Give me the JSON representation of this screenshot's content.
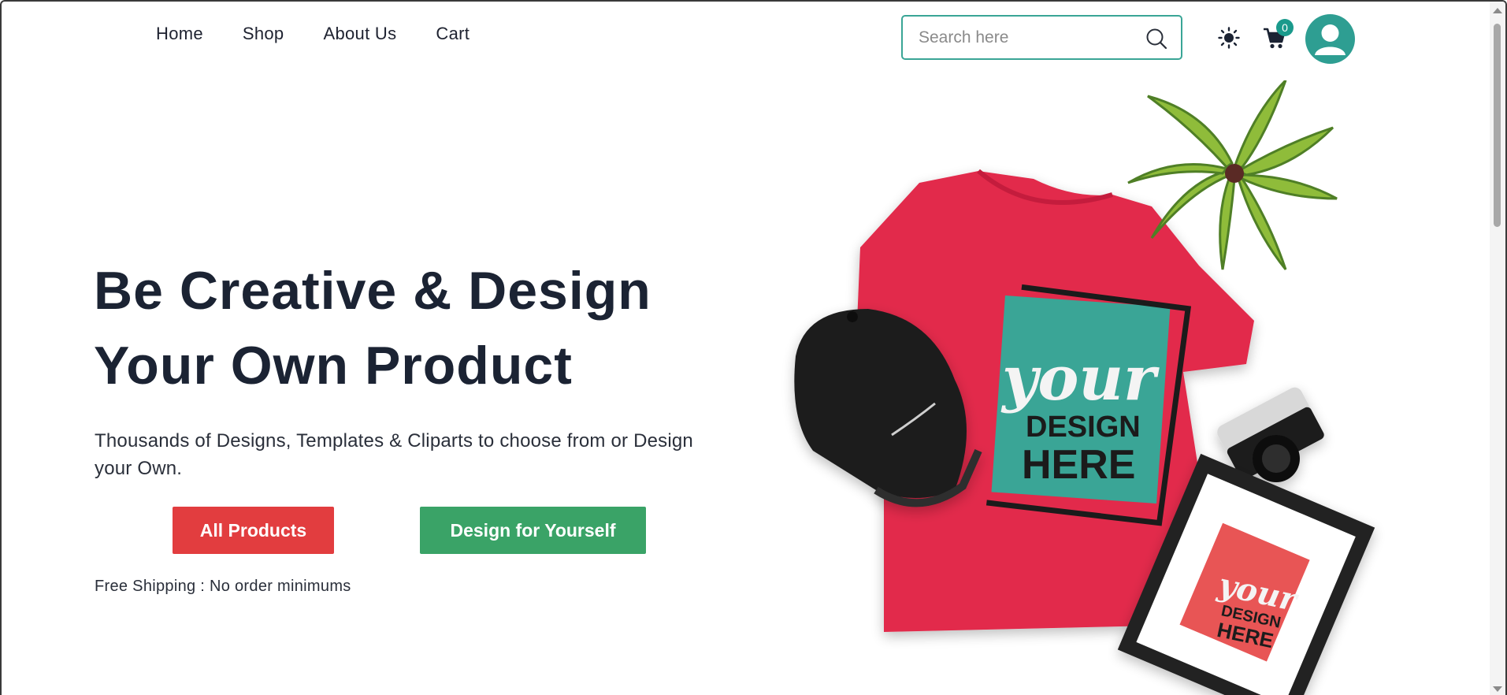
{
  "nav": {
    "links": [
      "Home",
      "Shop",
      "About Us",
      "Cart"
    ]
  },
  "search": {
    "placeholder": "Search here"
  },
  "cart": {
    "count": "0"
  },
  "hero": {
    "title": "Be Creative & Design Your Own Product",
    "subtitle": "Thousands of Designs, Templates & Cliparts to choose from or Design your Own.",
    "primary_button": "All Products",
    "secondary_button": "Design for Yourself",
    "shipping_note": "Free Shipping : No order minimums"
  },
  "art": {
    "shirt_text_top": "your",
    "shirt_text_middle": "DESIGN",
    "shirt_text_bottom": "HERE",
    "frame_text_top": "your",
    "frame_text_middle": "DESIGN",
    "frame_text_bottom": "HERE"
  },
  "icons": [
    "search-icon",
    "sun-icon",
    "cart-icon",
    "user-avatar-icon"
  ],
  "colors": {
    "accent_teal": "#3aa596",
    "button_red": "#e23d3f",
    "button_green": "#3aa367",
    "shirt_red": "#e22a4b",
    "text_dark": "#1b2333"
  }
}
